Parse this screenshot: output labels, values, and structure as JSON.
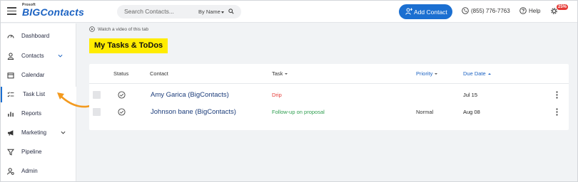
{
  "header": {
    "logo_small": "Prosoft",
    "logo_main": "BIGContacts",
    "search_placeholder": "Search Contacts...",
    "search_mode": "By Name",
    "add_contact_label": "Add Contact",
    "phone": "(855) 776-7763",
    "help_label": "Help",
    "settings_badge": "25%"
  },
  "sidebar": {
    "items": [
      {
        "label": "Dashboard",
        "icon": "dashboard-icon"
      },
      {
        "label": "Contacts",
        "icon": "person-icon"
      },
      {
        "label": "Calendar",
        "icon": "calendar-icon"
      },
      {
        "label": "Task List",
        "icon": "checklist-icon"
      },
      {
        "label": "Reports",
        "icon": "bar-chart-icon"
      },
      {
        "label": "Marketing",
        "icon": "megaphone-icon"
      },
      {
        "label": "Pipeline",
        "icon": "funnel-icon"
      },
      {
        "label": "Admin",
        "icon": "admin-person-icon"
      }
    ]
  },
  "main": {
    "video_link": "Watch a video of this tab",
    "title": "My Tasks & ToDos",
    "columns": {
      "status": "Status",
      "contact": "Contact",
      "task": "Task",
      "priority": "Priority",
      "due_date": "Due Date"
    },
    "rows": [
      {
        "contact": "Amy Garica (BigContacts)",
        "task": "Drip",
        "priority": "",
        "due": "Jul 15"
      },
      {
        "contact": "Johnson bane (BigContacts)",
        "task": "Follow-up on proposal",
        "priority": "Normal",
        "due": "Aug 08"
      }
    ]
  },
  "colors": {
    "brand_blue": "#1b6fd1",
    "highlight_yellow": "#ffec00",
    "task_red": "#e53935",
    "task_green": "#2e9e4f",
    "annotation_orange": "#f39a1f"
  }
}
